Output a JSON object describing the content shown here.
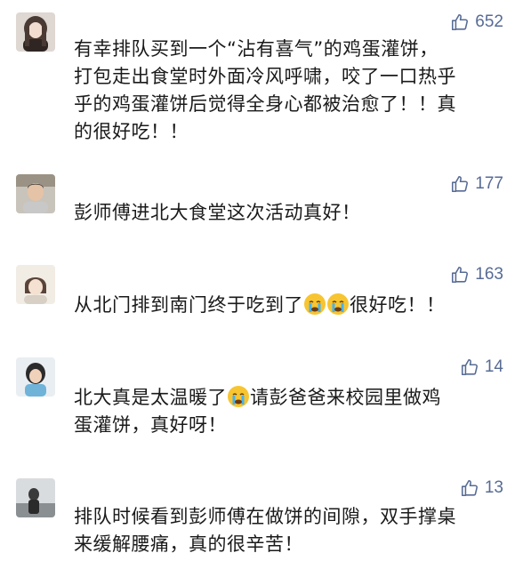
{
  "comments": [
    {
      "likes": "652",
      "avatar_icon": "user-avatar-icon",
      "lines": [
        "有幸排队买到一个“沾有喜气”的鸡蛋灌饼，",
        "打包走出食堂时外面冷风呼啸，咬了一口热乎",
        "乎的鸡蛋灌饼后觉得全身心都被治愈了！！真",
        "的很好吃！！"
      ]
    },
    {
      "likes": "177",
      "avatar_icon": "user-avatar-icon",
      "lines": [
        "彭师傅进北大食堂这次活动真好！"
      ]
    },
    {
      "likes": "163",
      "avatar_icon": "user-avatar-icon",
      "text_before": "从北门排到南门终于吃到了",
      "text_after": "很好吃！！",
      "emoji_icon": "crying-face-icon"
    },
    {
      "likes": "14",
      "avatar_icon": "user-avatar-icon",
      "line1_before": "北大真是太温暖了",
      "line1_after": "请彭爸爸来校园里做鸡",
      "line2": "蛋灌饼，真好呀！",
      "emoji_icon": "crying-face-icon"
    },
    {
      "likes": "13",
      "avatar_icon": "user-avatar-icon",
      "lines": [
        "排队时候看到彭师傅在做饼的间隙，双手撑桌",
        "来缓解腰痛，真的很辛苦！"
      ]
    }
  ],
  "colors": {
    "like": "#576b95",
    "text": "#1a1a1a",
    "background": "#ffffff"
  }
}
